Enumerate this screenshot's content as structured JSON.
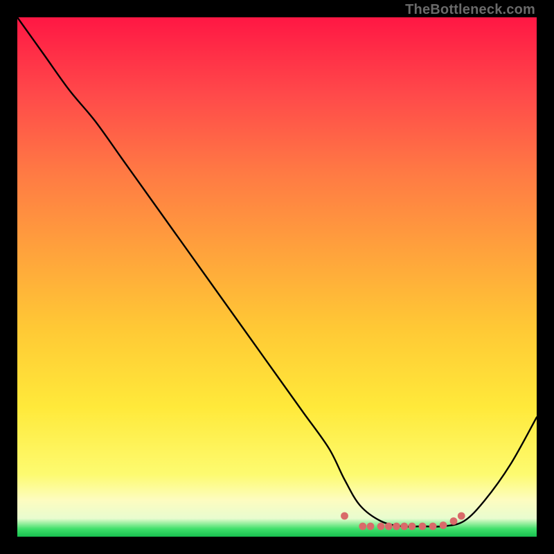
{
  "watermark": "TheBottleneck.com",
  "chart_data": {
    "type": "line",
    "title": "",
    "xlabel": "",
    "ylabel": "",
    "xlim": [
      0,
      100
    ],
    "ylim": [
      0,
      100
    ],
    "grid": false,
    "legend": false,
    "series": [
      {
        "name": "bottleneck-curve",
        "color": "#000000",
        "x": [
          0,
          5,
          10,
          15,
          20,
          25,
          30,
          35,
          40,
          45,
          50,
          55,
          60,
          63,
          66,
          70,
          74,
          78,
          82,
          86,
          90,
          95,
          100
        ],
        "y": [
          100,
          93,
          86,
          80,
          73,
          66,
          59,
          52,
          45,
          38,
          31,
          24,
          17,
          11,
          6,
          3,
          2,
          2,
          2,
          3,
          7,
          14,
          23
        ]
      },
      {
        "name": "optimal-range-markers",
        "type": "scatter",
        "color": "#d96a6a",
        "x": [
          63,
          66.5,
          68,
          70,
          71.5,
          73,
          74.5,
          76,
          78,
          80,
          82,
          84,
          85.5
        ],
        "y": [
          4,
          2,
          2,
          2,
          2,
          2,
          2,
          2,
          2,
          2,
          2.2,
          3,
          4
        ]
      }
    ],
    "background_gradient": {
      "type": "vertical",
      "stops": [
        {
          "pos": 0.0,
          "color": "#ff1744"
        },
        {
          "pos": 0.15,
          "color": "#ff4a4a"
        },
        {
          "pos": 0.3,
          "color": "#ff7a44"
        },
        {
          "pos": 0.45,
          "color": "#ffa23c"
        },
        {
          "pos": 0.6,
          "color": "#ffc935"
        },
        {
          "pos": 0.75,
          "color": "#ffe93a"
        },
        {
          "pos": 0.88,
          "color": "#fdfb70"
        },
        {
          "pos": 0.93,
          "color": "#fdfcc0"
        },
        {
          "pos": 0.965,
          "color": "#e8fccf"
        },
        {
          "pos": 0.985,
          "color": "#3fe06a"
        },
        {
          "pos": 1.0,
          "color": "#18c050"
        }
      ]
    }
  }
}
